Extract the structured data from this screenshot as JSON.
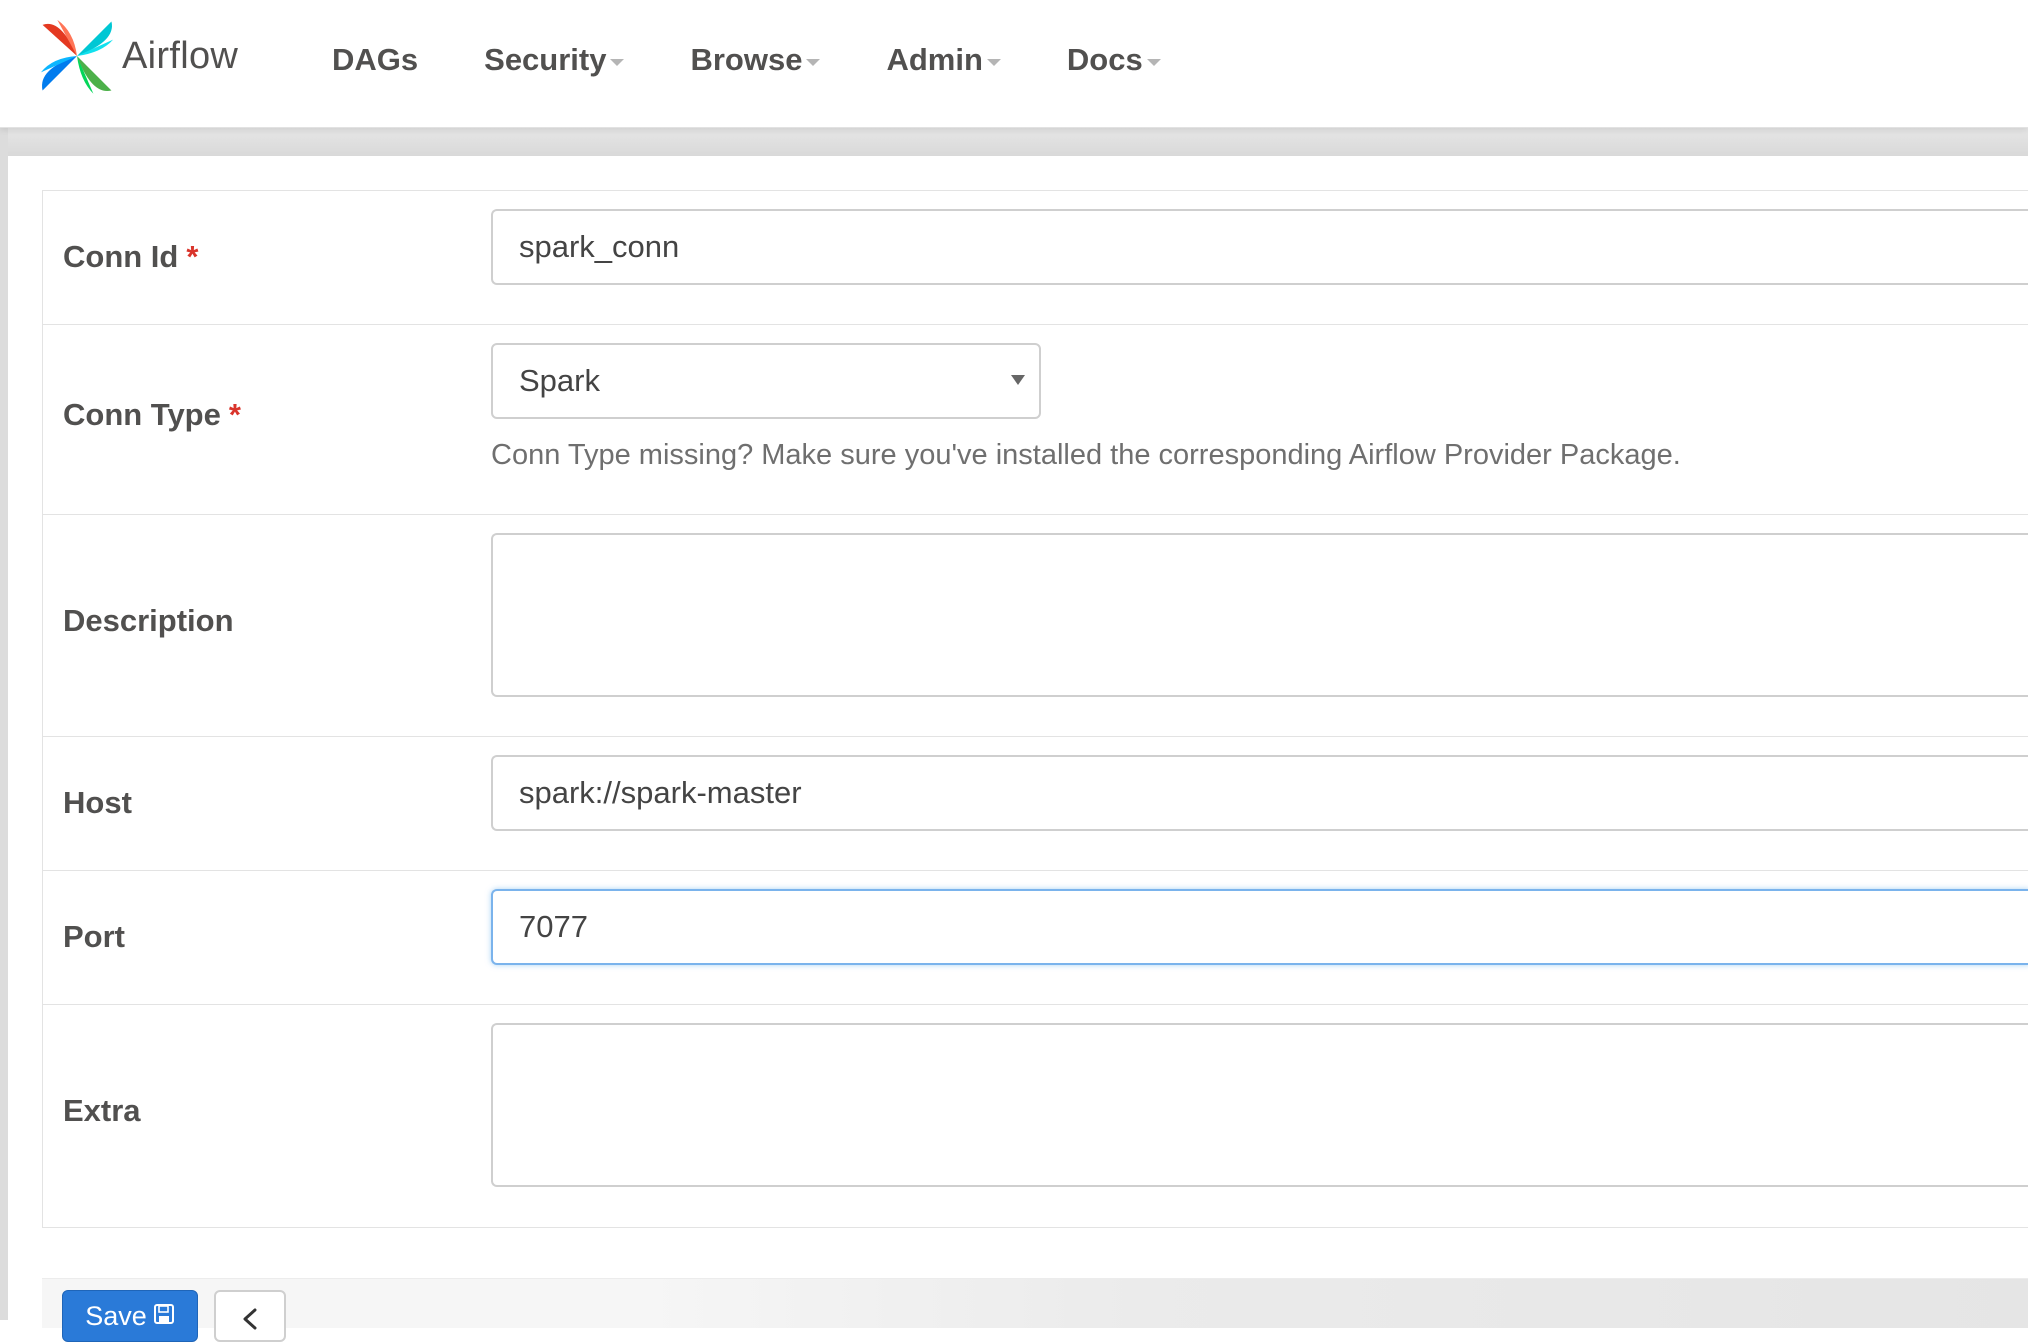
{
  "brand": {
    "name": "Airflow"
  },
  "nav": {
    "items": [
      {
        "label": "DAGs",
        "dropdown": false
      },
      {
        "label": "Security",
        "dropdown": true
      },
      {
        "label": "Browse",
        "dropdown": true
      },
      {
        "label": "Admin",
        "dropdown": true
      },
      {
        "label": "Docs",
        "dropdown": true
      }
    ]
  },
  "form": {
    "conn_id": {
      "label": "Conn Id",
      "required_mark": "*",
      "value": "spark_conn"
    },
    "conn_type": {
      "label": "Conn Type",
      "required_mark": "*",
      "selected": "Spark",
      "help": "Conn Type missing? Make sure you've installed the corresponding Airflow Provider Package."
    },
    "description": {
      "label": "Description",
      "value": ""
    },
    "host": {
      "label": "Host",
      "value": "spark://spark-master"
    },
    "port": {
      "label": "Port",
      "value": "7077"
    },
    "extra": {
      "label": "Extra",
      "value": ""
    }
  },
  "buttons": {
    "save_label": "Save",
    "save_icon": "floppy-disk-icon",
    "back_icon": "back-arrow-icon"
  },
  "colors": {
    "primary": "#2a7ad8",
    "required": "#d9342b",
    "focus": "#7ab3ec"
  }
}
